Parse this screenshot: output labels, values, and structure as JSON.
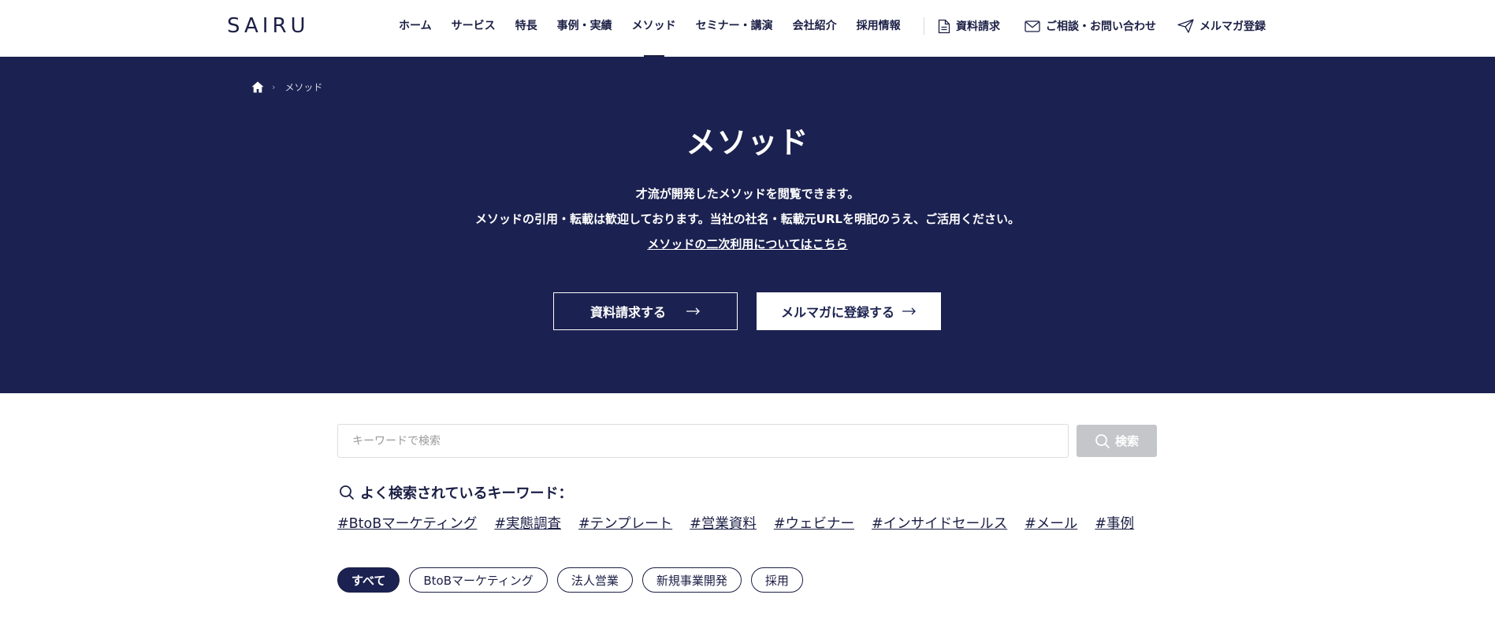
{
  "header": {
    "logo": "SAIRU",
    "nav": [
      {
        "label": "ホーム"
      },
      {
        "label": "サービス"
      },
      {
        "label": "特長"
      },
      {
        "label": "事例・実績"
      },
      {
        "label": "メソッド",
        "active": true
      },
      {
        "label": "セミナー・講演"
      },
      {
        "label": "会社紹介"
      },
      {
        "label": "採用情報"
      }
    ],
    "utility": {
      "document_request": "資料請求",
      "contact": "ご相談・お問い合わせ",
      "newsletter": "メルマガ登録"
    }
  },
  "hero": {
    "breadcrumb": {
      "home_icon": "home-icon",
      "current": "メソッド"
    },
    "title": "メソッド",
    "lead_line1": "才流が開発したメソッドを閲覧できます。",
    "lead_line2": "メソッドの引用・転載は歓迎しております。当社の社名・転載元URLを明記のうえ、ご活用ください。",
    "secondary_use_link": "メソッドの二次利用についてはこちら",
    "button_document": "資料請求する",
    "button_newsletter": "メルマガに登録する",
    "background_color": "#1b2150"
  },
  "search": {
    "placeholder": "キーワードで検索",
    "value": "",
    "button_label": "検索"
  },
  "popular_keywords": {
    "heading": "よく検索されているキーワード：",
    "items": [
      "#BtoBマーケティング",
      "#実態調査",
      "#テンプレート",
      "#営業資料",
      "#ウェビナー",
      "#インサイドセールス",
      "#メール",
      "#事例"
    ]
  },
  "category_filters": {
    "items": [
      {
        "label": "すべて",
        "active": true
      },
      {
        "label": "BtoBマーケティング"
      },
      {
        "label": "法人営業"
      },
      {
        "label": "新規事業開発"
      },
      {
        "label": "採用"
      }
    ]
  }
}
